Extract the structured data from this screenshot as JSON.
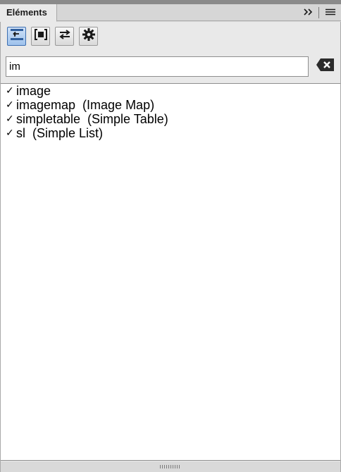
{
  "panel": {
    "tab_label": "Eléments",
    "expand_label": ">>"
  },
  "toolbar": {
    "buttons": [
      {
        "icon": "swap-element-icon",
        "active": true
      },
      {
        "icon": "insert-element-icon",
        "active": false
      },
      {
        "icon": "change-element-icon",
        "active": false
      },
      {
        "icon": "settings-gear-icon",
        "active": false
      }
    ]
  },
  "search": {
    "value": "im",
    "clear_icon": "clear-text-icon"
  },
  "elements": {
    "items": [
      {
        "check": "✓",
        "label": "image"
      },
      {
        "check": "✓",
        "label": "imagemap  (Image Map)"
      },
      {
        "check": "✓",
        "label": "simpletable  (Simple Table)"
      },
      {
        "check": "✓",
        "label": "sl  (Simple List)"
      }
    ]
  },
  "colors": {
    "panel_bg": "#e9e9e9",
    "active_button": "#9ec2ec",
    "accent_blue": "#2f5f9e"
  }
}
